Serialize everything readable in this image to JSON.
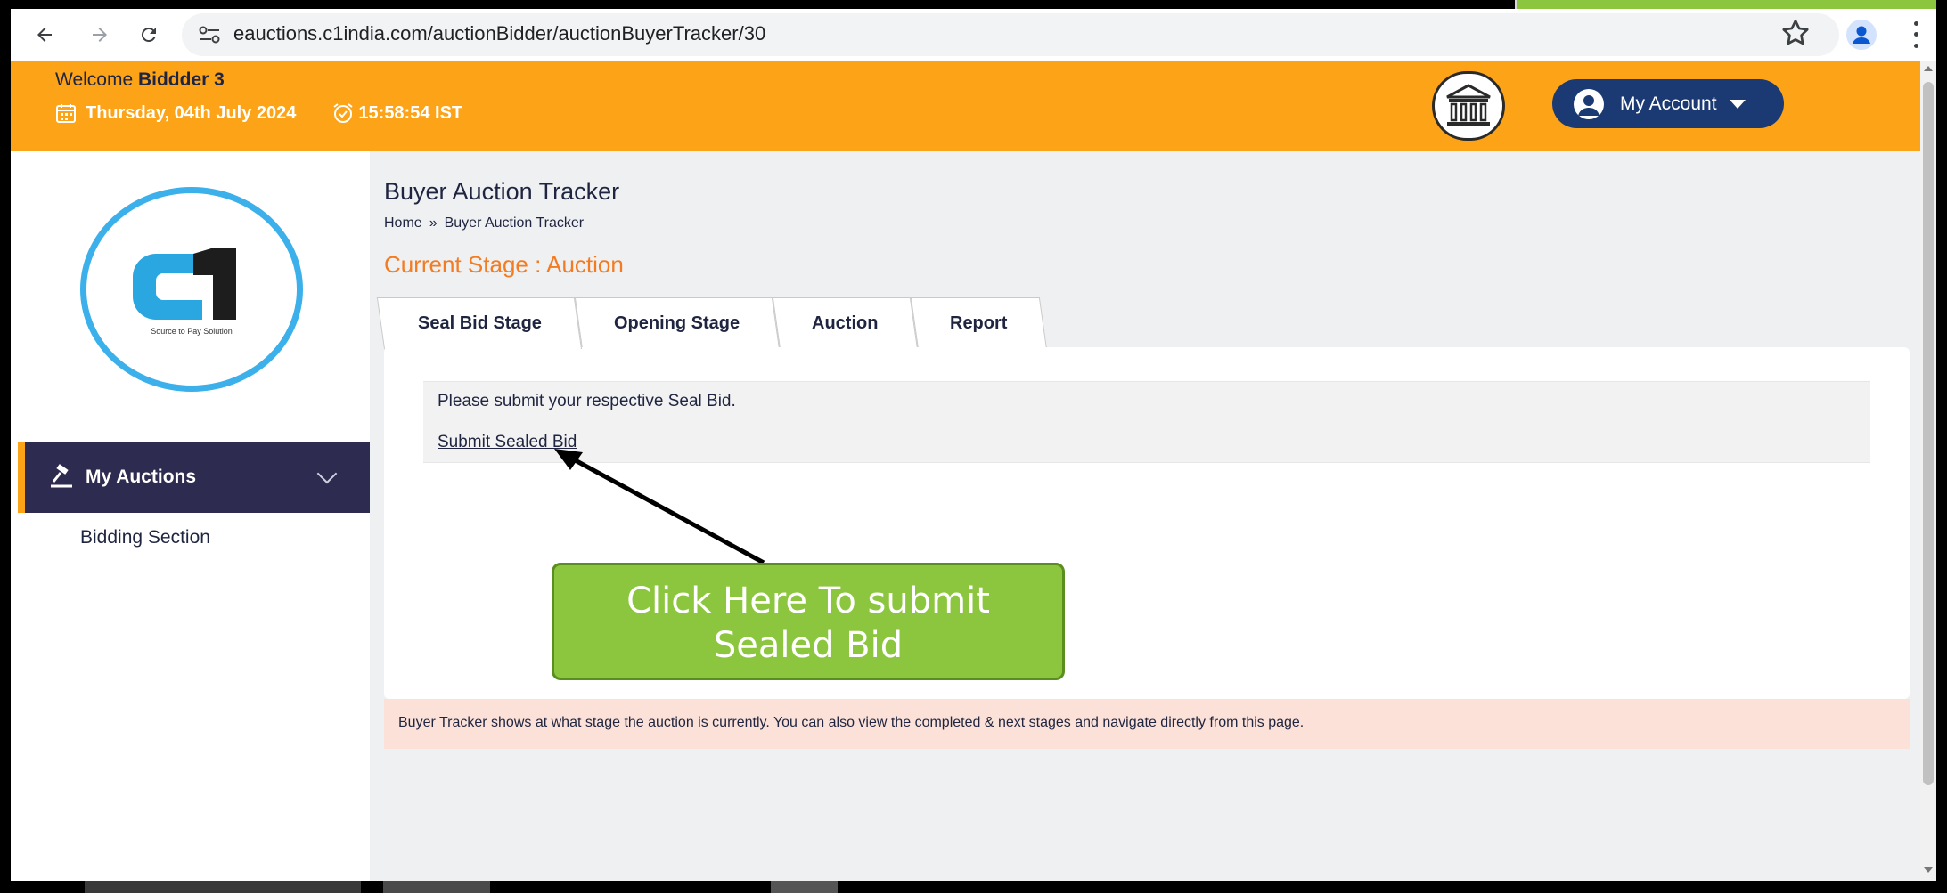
{
  "browser": {
    "url": "eauctions.c1india.com/auctionBidder/auctionBuyerTracker/30"
  },
  "header": {
    "welcome_prefix": "Welcome",
    "user_name": "Biddder 3",
    "date": "Thursday, 04th July 2024",
    "time": "15:58:54 IST",
    "account_label": "My Account",
    "accent_color": "#fca318",
    "account_color": "#1b3a73"
  },
  "sidebar": {
    "logo_tagline": "Source to Pay Solution",
    "menu_label": "My Auctions",
    "sub_items": [
      {
        "label": "Bidding Section"
      }
    ]
  },
  "main": {
    "title": "Buyer Auction Tracker",
    "breadcrumb": {
      "home": "Home",
      "separator": "»",
      "current": "Buyer Auction Tracker"
    },
    "current_stage": "Current Stage : Auction",
    "tabs": [
      {
        "label": "Seal Bid Stage",
        "active": true
      },
      {
        "label": "Opening Stage",
        "active": false
      },
      {
        "label": "Auction",
        "active": false
      },
      {
        "label": "Report",
        "active": false
      }
    ],
    "notice": "Please submit your respective Seal Bid.",
    "submit_link": "Submit Sealed Bid",
    "info": "Buyer Tracker shows at what stage the auction is currently. You can also view the completed & next stages and navigate directly from this page."
  },
  "annotation": {
    "callout_line1": "Click Here To submit",
    "callout_line2": "Sealed Bid",
    "callout_color": "#8cc63f"
  }
}
